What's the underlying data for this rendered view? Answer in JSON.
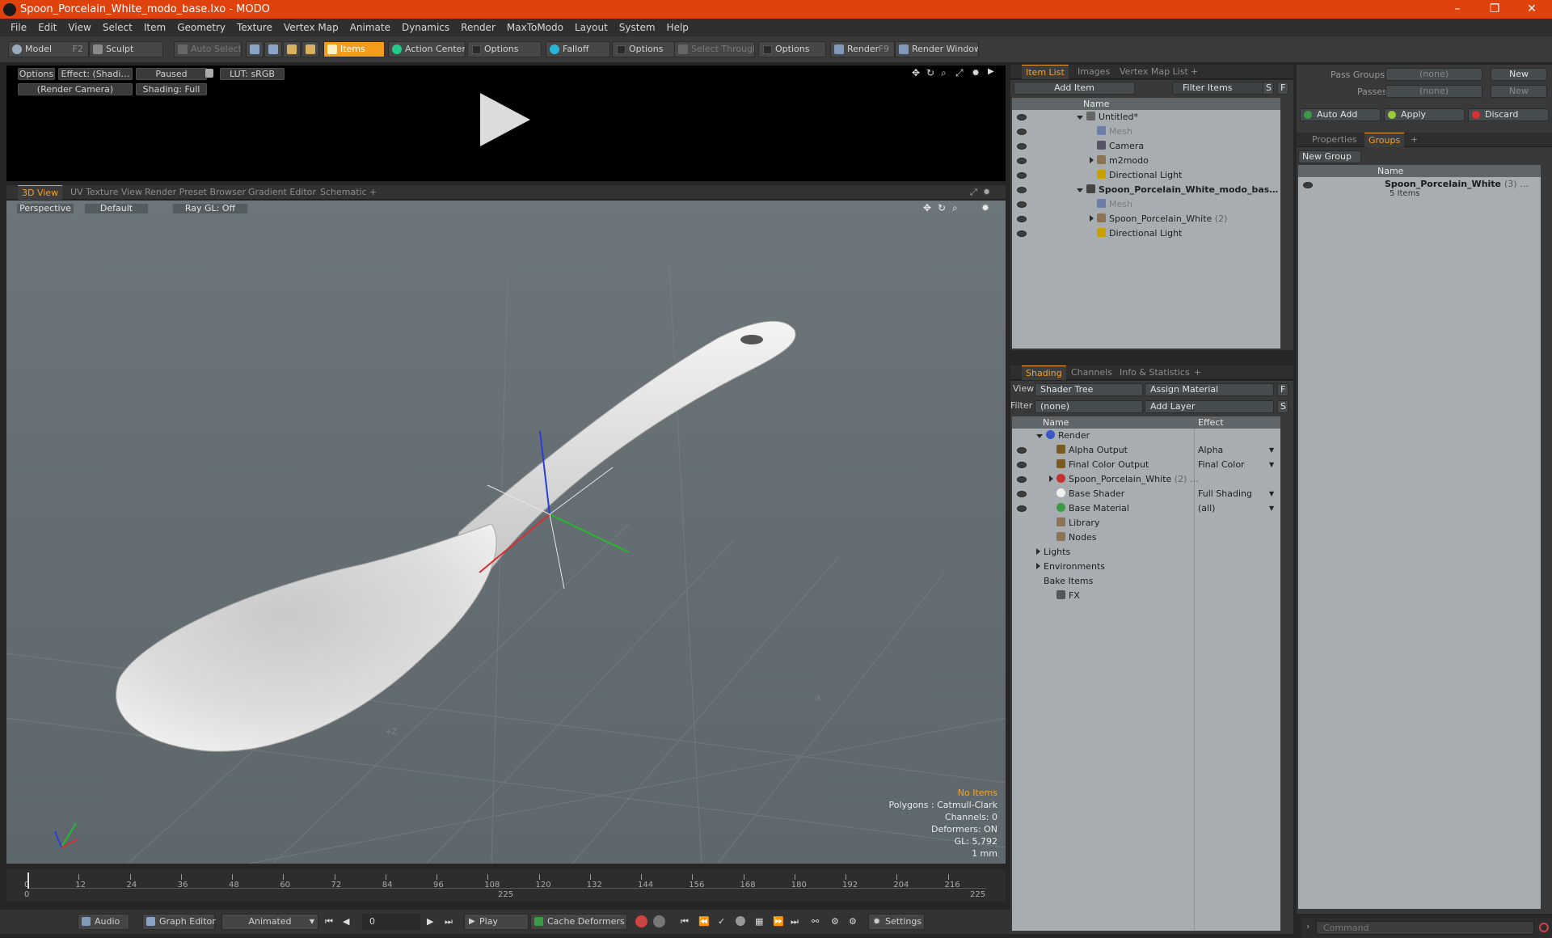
{
  "app": {
    "title": "Spoon_Porcelain_White_modo_base.lxo - MODO",
    "controls": {
      "minimize": "–",
      "maximize": "❐",
      "close": "✕"
    }
  },
  "menu": [
    "File",
    "Edit",
    "View",
    "Select",
    "Item",
    "Geometry",
    "Texture",
    "Vertex Map",
    "Animate",
    "Dynamics",
    "Render",
    "MaxToModo",
    "Layout",
    "System",
    "Help"
  ],
  "toolbar": {
    "model": "Model",
    "model_key": "F2",
    "sculpt": "Sculpt",
    "auto_select": "Auto Select",
    "items": "Items",
    "action_center": "Action Center",
    "options1": "Options",
    "falloff": "Falloff",
    "options2": "Options",
    "select_through": "Select Through",
    "options3": "Options",
    "render": "Render",
    "render_key": "F9",
    "render_window": "Render Window"
  },
  "preview": {
    "options": "Options",
    "effect": "Effect: (Shadi…",
    "paused": "Paused",
    "lut": "LUT: sRGB",
    "camera": "(Render Camera)",
    "shading": "Shading: Full"
  },
  "viewport_tabs": [
    "3D View",
    "UV Texture View",
    "Render Preset Browser",
    "Gradient Editor",
    "Schematic",
    "+"
  ],
  "viewport": {
    "projection": "Perspective",
    "style": "Default",
    "raygl": "Ray GL: Off",
    "axis_z": "+Z",
    "axis_x": "-X"
  },
  "stats": {
    "items": "No Items",
    "polygons": "Polygons : Catmull-Clark",
    "channels": "Channels: 0",
    "deformers": "Deformers: ON",
    "gl": "GL: 5,792",
    "unit": "1 mm"
  },
  "timeline": {
    "ticks": [
      "0",
      "12",
      "24",
      "36",
      "48",
      "60",
      "72",
      "84",
      "96",
      "108",
      "120",
      "132",
      "144",
      "156",
      "168",
      "180",
      "192",
      "204",
      "216"
    ],
    "start": "0",
    "mid": "225",
    "end": "225"
  },
  "bottom": {
    "audio": "Audio",
    "graph_editor": "Graph Editor",
    "animated": "Animated",
    "frame": "0",
    "play": "Play",
    "cache": "Cache Deformers",
    "settings": "Settings"
  },
  "itemlist": {
    "tabs": [
      "Item List",
      "Images",
      "Vertex Map List",
      "+"
    ],
    "add_item": "Add Item",
    "filter": "Filter Items",
    "s": "S",
    "f": "F",
    "col_name": "Name",
    "rows": [
      {
        "label": "Untitled*",
        "dim": false,
        "bold": false
      },
      {
        "label": "Mesh",
        "dim": true,
        "bold": false
      },
      {
        "label": "Camera",
        "dim": false,
        "bold": false
      },
      {
        "label": "m2modo",
        "dim": false,
        "bold": false
      },
      {
        "label": "Directional Light",
        "dim": false,
        "bold": false
      },
      {
        "label": "Spoon_Porcelain_White_modo_bas…",
        "dim": false,
        "bold": true
      },
      {
        "label": "Mesh",
        "dim": true,
        "bold": false
      },
      {
        "label": "Spoon_Porcelain_White",
        "count": "(2)",
        "dim": false,
        "bold": false
      },
      {
        "label": "Directional Light",
        "dim": false,
        "bold": false
      }
    ]
  },
  "shading": {
    "tabs": [
      "Shading",
      "Channels",
      "Info & Statistics",
      "+"
    ],
    "view_label": "View",
    "view_value": "Shader Tree",
    "assign": "Assign Material",
    "f": "F",
    "filter_label": "Filter",
    "filter_value": "(none)",
    "add_layer": "Add Layer",
    "s": "S",
    "col_name": "Name",
    "col_effect": "Effect",
    "rows": [
      {
        "label": "Render",
        "effect": ""
      },
      {
        "label": "Alpha Output",
        "effect": "Alpha"
      },
      {
        "label": "Final Color Output",
        "effect": "Final Color"
      },
      {
        "label": "Spoon_Porcelain_White",
        "count": "(2) …",
        "effect": ""
      },
      {
        "label": "Base Shader",
        "effect": "Full Shading"
      },
      {
        "label": "Base Material",
        "effect": "(all)"
      },
      {
        "label": "Library",
        "effect": ""
      },
      {
        "label": "Nodes",
        "effect": ""
      },
      {
        "label": "Lights",
        "effect": ""
      },
      {
        "label": "Environments",
        "effect": ""
      },
      {
        "label": "Bake Items",
        "effect": ""
      },
      {
        "label": "FX",
        "effect": ""
      }
    ]
  },
  "groups": {
    "pass_groups": "Pass Groups",
    "pass_groups_val": "(none)",
    "passes": "Passes",
    "passes_val": "(none)",
    "new": "New",
    "new2": "New",
    "auto_add": "Auto Add",
    "apply": "Apply",
    "discard": "Discard",
    "tabs": [
      "Properties",
      "Groups",
      "+"
    ],
    "new_group": "New Group",
    "col_name": "Name",
    "group_name": "Spoon_Porcelain_White",
    "group_count": "(3) …",
    "group_sub": "5 Items"
  },
  "command": {
    "placeholder": "Command"
  },
  "colors": {
    "accent": "#f39c1a",
    "title": "#e0420e",
    "panel": "#a7adb1"
  }
}
